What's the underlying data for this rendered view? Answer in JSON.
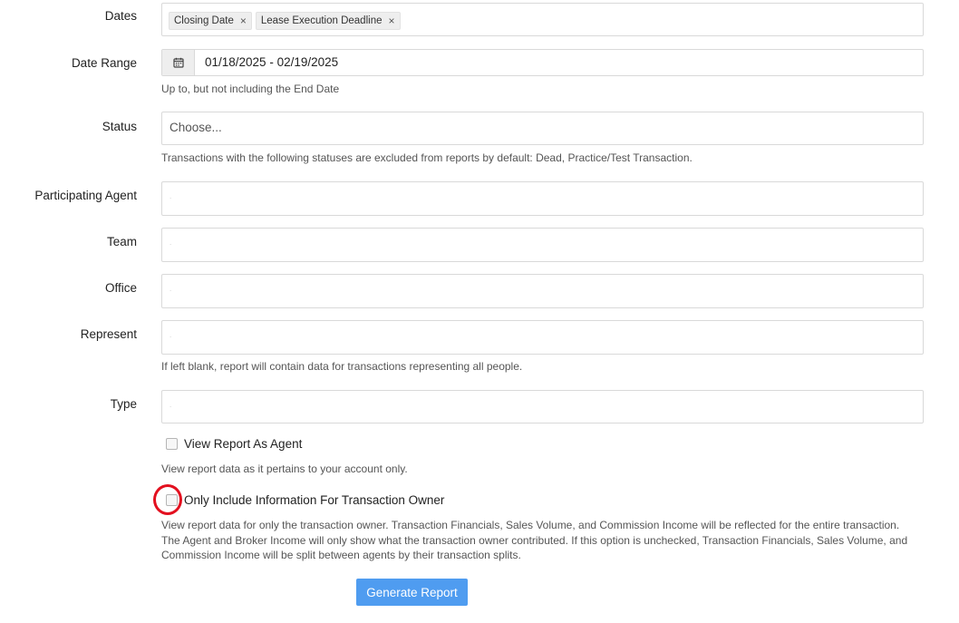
{
  "dates": {
    "label": "Dates",
    "tags": [
      {
        "text": "Closing Date",
        "remove": "×"
      },
      {
        "text": "Lease Execution Deadline",
        "remove": "×"
      }
    ]
  },
  "date_range": {
    "label": "Date Range",
    "value": "01/18/2025 - 02/19/2025",
    "help": "Up to, but not including the End Date",
    "icon": "calendar-icon"
  },
  "status": {
    "label": "Status",
    "placeholder": "Choose...",
    "help": "Transactions with the following statuses are excluded from reports by default: Dead, Practice/Test Transaction."
  },
  "participating_agent": {
    "label": "Participating Agent"
  },
  "team": {
    "label": "Team"
  },
  "office": {
    "label": "Office"
  },
  "represent": {
    "label": "Represent",
    "help": "If left blank, report will contain data for transactions representing all people."
  },
  "type": {
    "label": "Type"
  },
  "view_as_agent": {
    "label": "View Report As Agent",
    "checked": false,
    "help": "View report data as it pertains to your account only."
  },
  "owner_only": {
    "label": "Only Include Information For Transaction Owner",
    "checked": false,
    "help_lines": [
      "View report data for only the transaction owner. Transaction Financials, Sales Volume, and Commission Income will be reflected for the entire transaction.",
      "The Agent and Broker Income will only show what the transaction owner contributed. If this option is unchecked, Transaction Financials, Sales Volume, and",
      "Commission Income will be split between agents by their transaction splits."
    ]
  },
  "submit": {
    "label": "Generate Report"
  },
  "colors": {
    "accent": "#4f9cf0",
    "highlight": "#e3101f"
  }
}
